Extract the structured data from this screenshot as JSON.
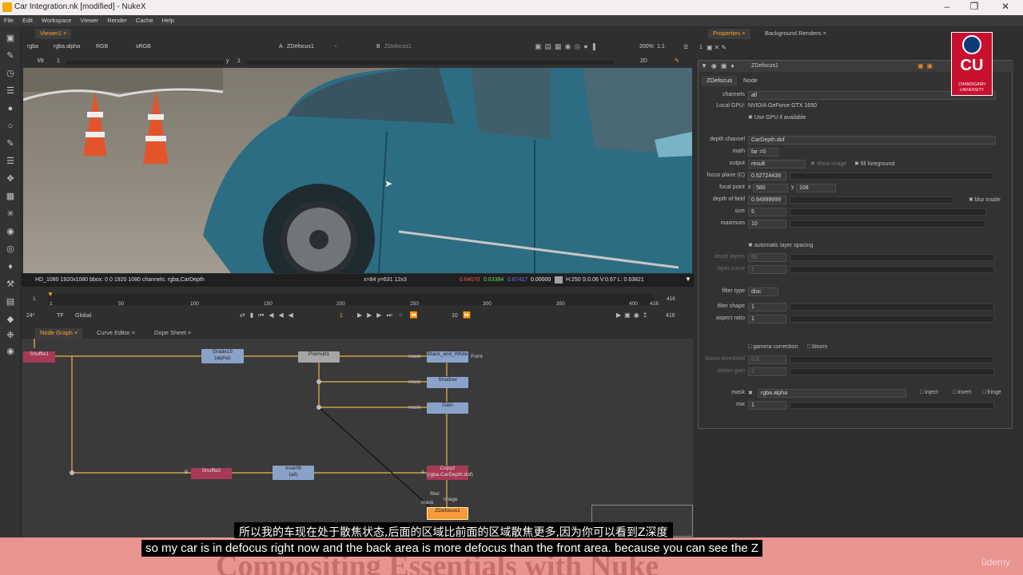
{
  "window": {
    "title": "Car Integration.nk [modified] - NukeX"
  },
  "menu": [
    "File",
    "Edit",
    "Workspace",
    "Viewer",
    "Render",
    "Cache",
    "Help"
  ],
  "viewer": {
    "tab": "Viewer1",
    "layer": "rgba",
    "channel": "rgba.alpha",
    "colorspace_in": "RGB",
    "lut": "sRGB",
    "input_a_label": "A",
    "input_a": "ZDefocus1",
    "input_a_op": "-",
    "input_b_label": "B",
    "input_b": "ZDefocus1",
    "frame_label": "f/8",
    "frame_value": "1",
    "y_label": "y",
    "y_value": "1",
    "zoom": "200%",
    "ratio": "1:1",
    "view_mode": "2D",
    "status_format": "HD_1080 1920x1080  bbox: 0 0 1920 1080 channels: rgba,CarDepth",
    "status_coords": "x=84 y=631 12x3",
    "status_r": "0.64070",
    "status_g": "0.63384",
    "status_b": "0.67417",
    "status_a": "0.00000",
    "status_hsv": "H:250 S:0.06 V:0.67  L: 0.63821"
  },
  "timeline": {
    "ticks": [
      "1",
      "50",
      "100",
      "150",
      "200",
      "250",
      "300",
      "350",
      "400",
      "416"
    ],
    "start": "1",
    "end": "416",
    "fps": "24*",
    "tf": "TF",
    "scope": "Global",
    "current_frame": "1",
    "step": "10",
    "end_frame": "416"
  },
  "nodegraph": {
    "tabs": [
      "Node Graph",
      "Curve Editor",
      "Dope Sheet"
    ],
    "nodes": {
      "shuffle_top": "Shuffle1",
      "grade": "Grade15",
      "grade_sub": "(alpha)",
      "premult": "Premult1",
      "bw": "Black_and_White",
      "shadow": "Shadow",
      "gain": "Gain",
      "shuffle_bottom": "Shuffle2",
      "invert": "Invert6",
      "invert_sub": "(all)",
      "copy": "Copy2",
      "copy_sub": "(rgba.CarDepth.dof)",
      "zdefocus": "ZDefocus1"
    },
    "edge_labels": {
      "mask1": "mask",
      "mask2": "mask",
      "mask3": "mask",
      "b": "B",
      "a": "A",
      "filter": "filter",
      "image": "image",
      "mask4": "mask",
      "point": "Point"
    }
  },
  "properties": {
    "tabs": [
      "Properties",
      "Background Renders"
    ],
    "panel_count": "1",
    "node_name": "ZDefocus1",
    "subtabs": [
      "ZDefocus",
      "Node"
    ],
    "channels_label": "channels",
    "channels": "all",
    "gpu_label": "Local GPU:",
    "gpu": "NVIDIA GeForce GTX 1650",
    "use_gpu": "Use GPU if available",
    "depth_channel_label": "depth channel",
    "depth_channel": "CarDepth.dof",
    "math_label": "math",
    "math": "far =0",
    "output_label": "output",
    "output": "result",
    "show_image": "show image",
    "fill_foreground": "fill foreground",
    "focus_plane_label": "focus plane (C)",
    "focus_plane": "0.52724439",
    "focal_point_label": "focal point",
    "focal_x_label": "x",
    "focal_x": "580",
    "focal_y_label": "y",
    "focal_y": "108",
    "dof_label": "depth of field",
    "dof": "0.94999999",
    "blur_inside": "blur inside",
    "size_label": "size",
    "size": "5",
    "maximum_label": "maximum",
    "maximum": "10",
    "auto_layer": "automatic layer spacing",
    "depth_layers_label": "depth layers",
    "depth_layers": "50",
    "layer_curve_label": "layer curve",
    "layer_curve": "1",
    "filter_type_label": "filter type",
    "filter_type": "disc",
    "filter_shape_label": "filter shape",
    "filter_shape": "1",
    "aspect_ratio_label": "aspect ratio",
    "aspect_ratio": "1",
    "gamma_correction": "gamma correction",
    "bloom": "bloom",
    "bloom_threshold_label": "bloom threshold",
    "bloom_threshold": "0.8",
    "bloom_gain_label": "bloom gain",
    "bloom_gain": "2",
    "mask_label": "mask",
    "mask": "rgba.alpha",
    "inject": "inject",
    "invert": "invert",
    "fringe": "fringe",
    "mix_label": "mix",
    "mix": "1",
    "slider_ticks": [
      "0",
      "0.1",
      "0.2",
      "0.3",
      "0.4",
      "0.5",
      "0.6",
      "0.7",
      "0.8",
      "0.9",
      "1"
    ]
  },
  "logo": {
    "text": "CU",
    "name": "CHANDIGARH",
    "name2": "UNIVERSITY"
  },
  "subtitles": {
    "chinese": "所以我的车现在处于散焦状态,后面的区域比前面的区域散焦更多,因为你可以看到Z深度",
    "english": "so my car is in defocus right now and the back area is more defocus than the front area. because you can see the Z"
  },
  "watermark": "Compositing Essentials with Nuke",
  "udemy": "ûdemy",
  "colors": {
    "accent": "#ff9f2a",
    "banner": "#e89592",
    "car": "#2c6d83"
  }
}
